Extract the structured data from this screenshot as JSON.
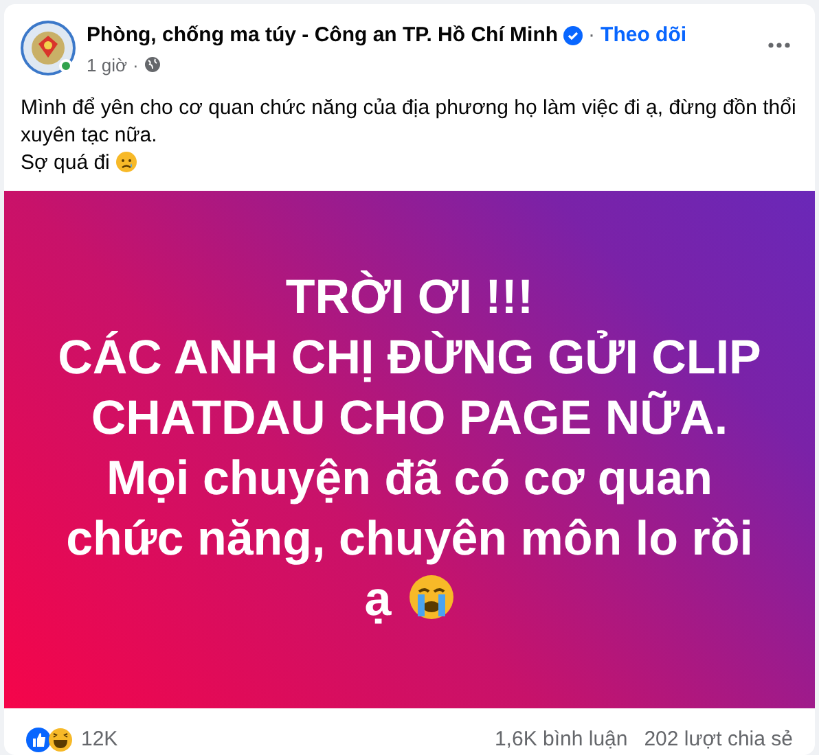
{
  "post": {
    "author": "Phòng, chống ma túy - Công an TP. Hồ Chí Minh",
    "verified": true,
    "separator": "·",
    "follow": "Theo dõi",
    "time": "1 giờ",
    "online": true,
    "text": [
      "Mình để yên cho cơ quan chức năng của địa phương họ làm việc đi ạ, đừng đồn thổi xuyên tạc nữa.",
      "Sợ quá đi"
    ],
    "banner_lines": [
      "TRỜI ƠI !!!",
      "CÁC ANH CHỊ ĐỪNG GỬI CLIP",
      "CHATDAU CHO PAGE NỮA.",
      "Mọi chuyện đã có cơ quan",
      "chức năng, chuyên môn lo rồi",
      "ạ"
    ]
  },
  "footer": {
    "reactions": "12K",
    "comments": "1,6K bình luận",
    "shares": "202 lượt chia sẻ"
  }
}
